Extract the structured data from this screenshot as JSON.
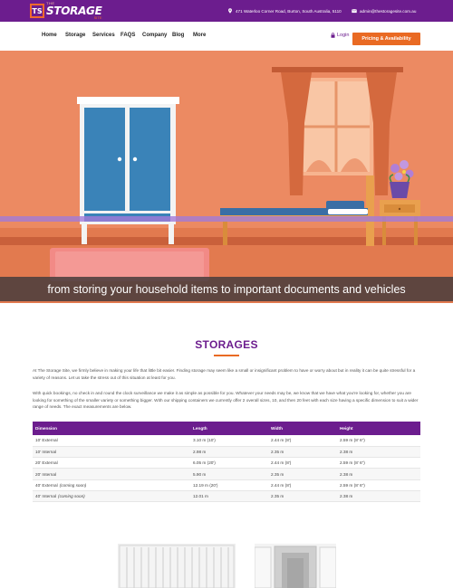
{
  "logo": {
    "mark": "TS",
    "small": "THE",
    "main": "STORAGE",
    "sub": "SITE"
  },
  "contact": {
    "address": "471 Waterloo Corner Road, Burton, South Australia, 5110",
    "email": "admin@thestoragesite.com.au"
  },
  "nav": {
    "items": [
      "Home",
      "Storage",
      "Services",
      "FAQS",
      "Company",
      "Blog",
      "More"
    ],
    "login": "Login",
    "cta": "Pricing & Availability"
  },
  "hero": {
    "caption": "from storing your household items to important documents and vehicles"
  },
  "section": {
    "title": "STORAGES",
    "paragraph1": "At The Storage Site, we firmly believe in making your life that little bit easier. Finding storage may seem like a small or insignificant problem to have or worry about but in reality it can be quite stressful for a variety of reasons. Let us take the stress out of this situation at least for you.",
    "paragraph2": "With quick bookings, no check in and round the clock surveillance we make it as simple as possible for you. Whatever your needs may be, we know that we have what you're looking for, whether you are looking for something of the smaller variety or something bigger. With our shipping containers we currently offer 2 overall sizes, 10, and then 20 feet with each size having a specific dimension to suit a wider range of needs. The exact measurements are below."
  },
  "table": {
    "headers": [
      "Dimension",
      "Length",
      "Width",
      "Height"
    ],
    "rows": [
      {
        "dimension": "10' External",
        "note": "",
        "length": "3.10 m (10')",
        "width": "2.44 m (8')",
        "height": "2.59 m (8' 6\")"
      },
      {
        "dimension": "10' Internal",
        "note": "",
        "length": "2.98 m",
        "width": "2.35 m",
        "height": "2.38 m"
      },
      {
        "dimension": "20' External",
        "note": "",
        "length": "6.05 m (20')",
        "width": "2.44 m (8')",
        "height": "2.59 m (8' 6\")"
      },
      {
        "dimension": "20' Internal",
        "note": "",
        "length": "5.90 m",
        "width": "2.35 m",
        "height": "2.38 m"
      },
      {
        "dimension": "40' External",
        "note": "(coming soon)",
        "length": "12.19 m (20')",
        "width": "2.44 m (8')",
        "height": "2.59 m (8' 6\")"
      },
      {
        "dimension": "40' Internal",
        "note": "(coming soon)",
        "length": "12.01 m",
        "width": "2.35 m",
        "height": "2.38 m"
      }
    ]
  },
  "colors": {
    "brand": "#6c1d8e",
    "accent": "#e96a23",
    "hero_bg": "#ec8a62"
  }
}
